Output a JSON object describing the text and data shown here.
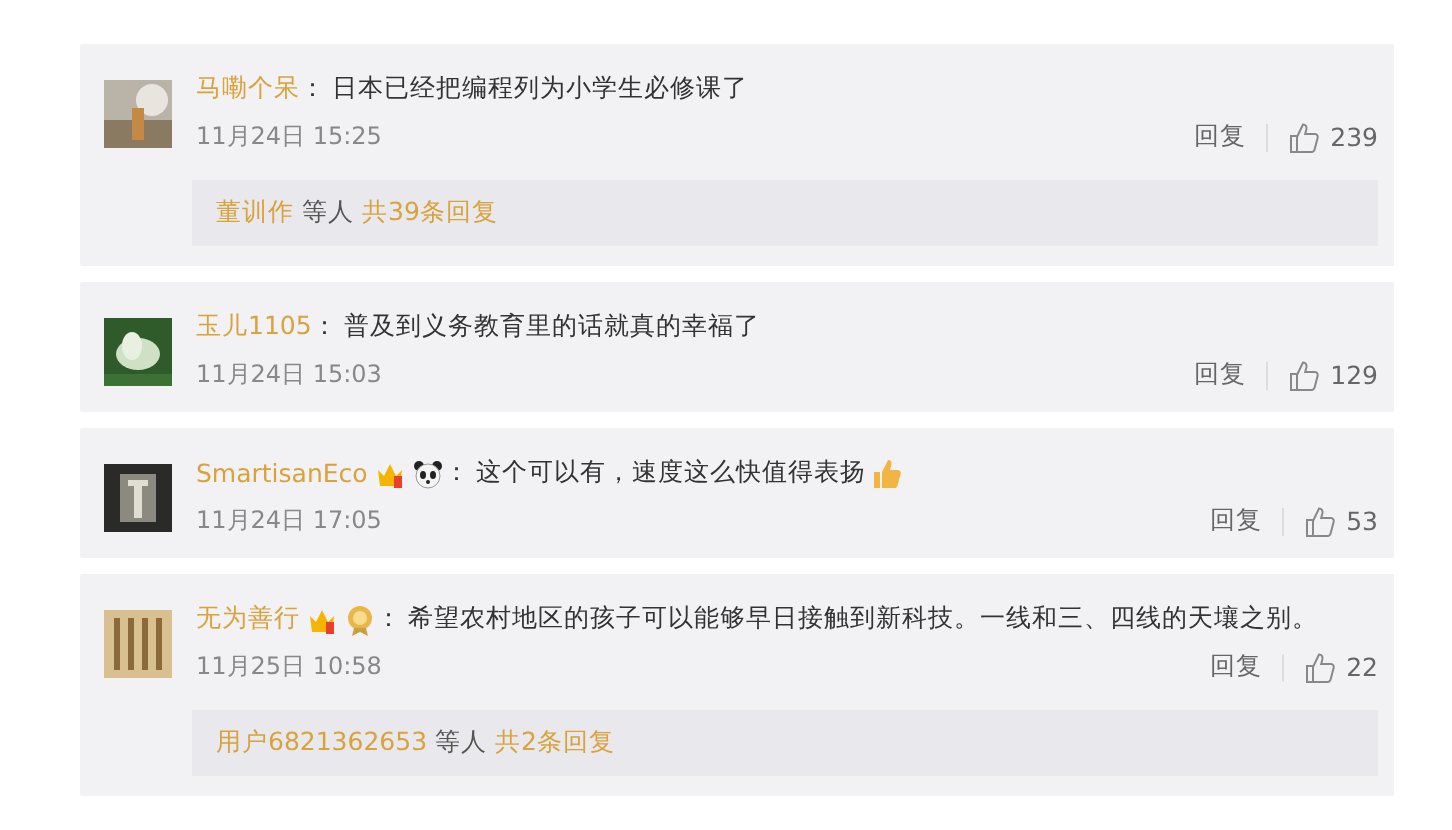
{
  "comments": [
    {
      "user": "马嘞个呆",
      "colon": "：",
      "text": "日本已经把编程列为小学生必修课了",
      "end_icon": false,
      "time": "11月24日 15:25",
      "reply": "回复",
      "likes": "239",
      "thread": {
        "names": "董训作",
        "middle": "等人",
        "total": "共39条回复"
      }
    },
    {
      "user": "玉儿1105",
      "colon": "：",
      "text": "普及到义务教育里的话就真的幸福了",
      "end_icon": false,
      "time": "11月24日 15:03",
      "reply": "回复",
      "likes": "129"
    },
    {
      "user": "SmartisanEco",
      "badges": [
        {
          "kind": "crown"
        },
        {
          "kind": "panda"
        }
      ],
      "colon": "：",
      "text": "这个可以有，速度这么快值得表扬",
      "end_icon": true,
      "time": "11月24日 17:05",
      "reply": "回复",
      "likes": "53"
    },
    {
      "user": "无为善行",
      "badges": [
        {
          "kind": "crown"
        },
        {
          "kind": "medal"
        }
      ],
      "colon": "：",
      "text": "希望农村地区的孩子可以能够早日接触到新科技。一线和三、四线的天壤之别。",
      "end_icon": false,
      "time": "11月25日 10:58",
      "reply": "回复",
      "likes": "22",
      "thread": {
        "names": "用户6821362653",
        "middle": "等人",
        "total": "共2条回复"
      }
    }
  ]
}
